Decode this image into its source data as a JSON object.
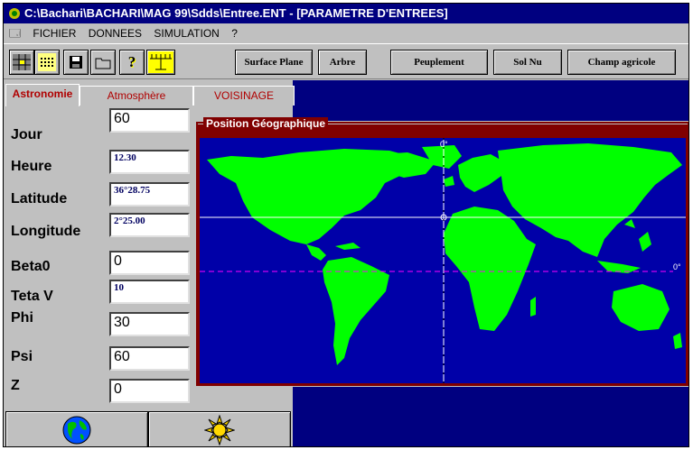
{
  "window": {
    "title": "C:\\Bachari\\BACHARI\\MAG 99\\Sdds\\Entree.ENT - [PARAMETRE D'ENTREES]"
  },
  "menu": {
    "items": [
      "FICHIER",
      "DONNEES",
      "SIMULATION",
      "?"
    ]
  },
  "toolbar": {
    "buttons": [
      "Surface Plane",
      "Arbre",
      "Peuplement",
      "Sol Nu",
      "Champ agricole"
    ]
  },
  "tabs": [
    "Astronomie",
    "Atmosphère",
    "VOISINAGE"
  ],
  "params": [
    {
      "label": "Jour",
      "value": "60"
    },
    {
      "label": "Heure",
      "value": "12.30"
    },
    {
      "label": "Latitude",
      "value": "36°28.75"
    },
    {
      "label": "Longitude",
      "value": "2°25.00"
    },
    {
      "label": "Beta0",
      "value": "0"
    },
    {
      "label": "Teta V",
      "value": "10"
    },
    {
      "label": "Phi",
      "value": "30"
    },
    {
      "label": "Psi",
      "value": "60"
    },
    {
      "label": "Z",
      "value": "0"
    }
  ],
  "map": {
    "title": "Position Géographique",
    "top_mark": "0°",
    "right_mark": "0°",
    "colors": {
      "ocean": "#0000a8",
      "land": "#00ff00",
      "frame": "#800000"
    }
  },
  "icons": {
    "bottom_left": "globe-icon",
    "bottom_right": "sun-icon"
  }
}
